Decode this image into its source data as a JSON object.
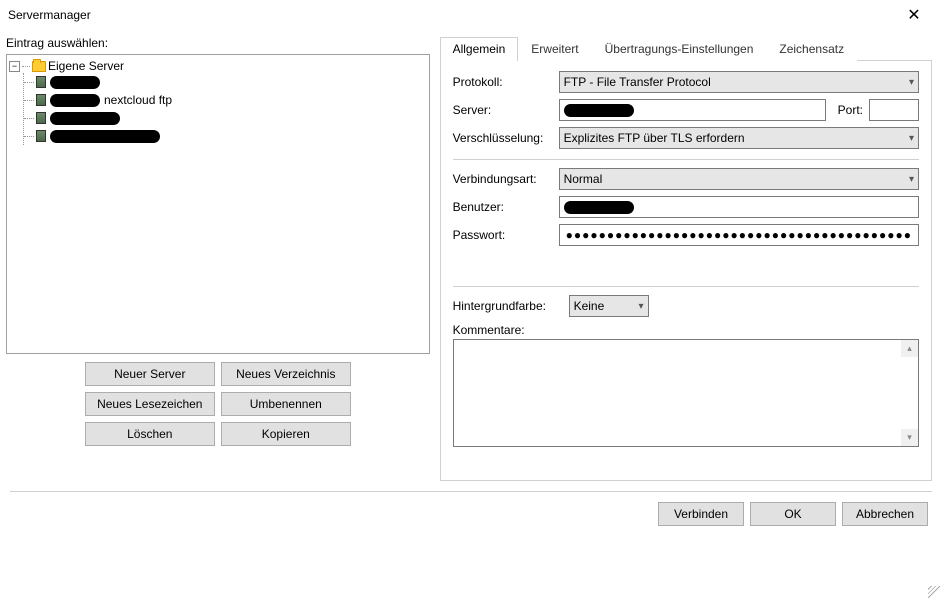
{
  "window": {
    "title": "Servermanager"
  },
  "left": {
    "label": "Eintrag auswählen:",
    "root": "Eigene Server",
    "items": [
      {
        "label": ""
      },
      {
        "label": "nextcloud ftp"
      },
      {
        "label": ""
      },
      {
        "label": ""
      }
    ],
    "buttons": {
      "new_server": "Neuer Server",
      "new_dir": "Neues Verzeichnis",
      "new_bookmark": "Neues Lesezeichen",
      "rename": "Umbenennen",
      "delete": "Löschen",
      "copy": "Kopieren"
    }
  },
  "tabs": {
    "general": "Allgemein",
    "advanced": "Erweitert",
    "transfer": "Übertragungs-Einstellungen",
    "charset": "Zeichensatz"
  },
  "form": {
    "protocol_label": "Protokoll:",
    "protocol_value": "FTP - File Transfer Protocol",
    "server_label": "Server:",
    "port_label": "Port:",
    "encryption_label": "Verschlüsselung:",
    "encryption_value": "Explizites FTP über TLS erfordern",
    "conntype_label": "Verbindungsart:",
    "conntype_value": "Normal",
    "user_label": "Benutzer:",
    "password_label": "Passwort:",
    "password_mask": "●●●●●●●●●●●●●●●●●●●●●●●●●●●●●●●●●●●●●●●●●●",
    "bgcolor_label": "Hintergrundfarbe:",
    "bgcolor_value": "Keine",
    "comments_label": "Kommentare:"
  },
  "dialog": {
    "connect": "Verbinden",
    "ok": "OK",
    "cancel": "Abbrechen"
  }
}
